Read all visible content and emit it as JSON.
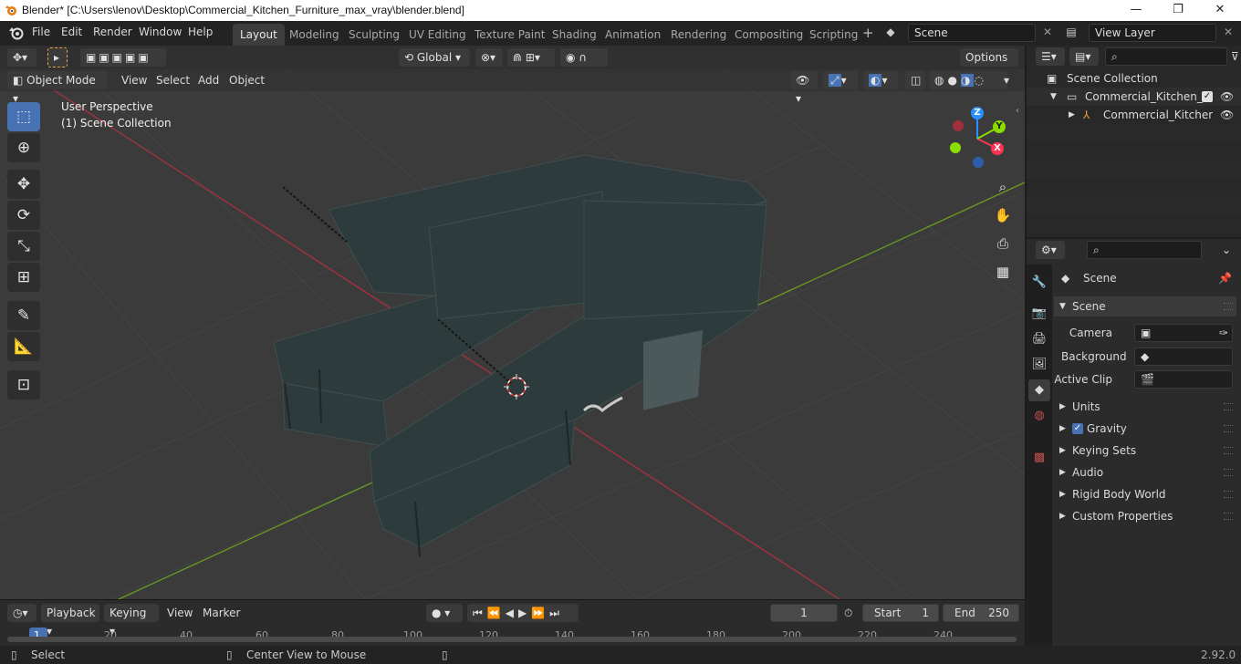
{
  "window": {
    "title": "Blender* [C:\\Users\\lenov\\Desktop\\Commercial_Kitchen_Furniture_max_vray\\blender.blend]",
    "minimize": "—",
    "maximize": "❐",
    "close": "✕"
  },
  "menu": [
    "File",
    "Edit",
    "Render",
    "Window",
    "Help"
  ],
  "workspaces": {
    "tabs": [
      "Layout",
      "Modeling",
      "Sculpting",
      "UV Editing",
      "Texture Paint",
      "Shading",
      "Animation",
      "Rendering",
      "Compositing",
      "Scripting"
    ],
    "active": "Layout",
    "add": "+"
  },
  "scene_selector": {
    "value": "Scene"
  },
  "view_layer_selector": {
    "value": "View Layer"
  },
  "viewport_header": {
    "transform_orientation": "Global",
    "options_label": "Options",
    "mode": "Object Mode",
    "menus": [
      "View",
      "Select",
      "Add",
      "Object"
    ]
  },
  "viewport_overlay": {
    "line1": "User Perspective",
    "line2": "(1) Scene Collection"
  },
  "gizmo": {
    "x": "X",
    "y": "Y",
    "z": "Z"
  },
  "timeline": {
    "menus": [
      "Playback",
      "Keying",
      "View",
      "Marker"
    ],
    "current_frame": "1",
    "start_label": "Start",
    "start_value": "1",
    "end_label": "End",
    "end_value": "250",
    "ruler_ticks": [
      "1",
      "20",
      "40",
      "60",
      "80",
      "100",
      "120",
      "140",
      "160",
      "180",
      "200",
      "220",
      "240"
    ]
  },
  "outliner": {
    "root": "Scene Collection",
    "items": [
      {
        "label": "Commercial_Kitchen_Fu"
      },
      {
        "label": "Commercial_Kitcher"
      }
    ]
  },
  "properties": {
    "context": "Scene",
    "panel_title": "Scene",
    "fields": [
      {
        "label": "Camera"
      },
      {
        "label": "Background ..."
      },
      {
        "label": "Active Clip"
      }
    ],
    "sections": [
      "Units",
      "Gravity",
      "Keying Sets",
      "Audio",
      "Rigid Body World",
      "Custom Properties"
    ]
  },
  "status": {
    "left": "Select",
    "middle": "Center View to Mouse",
    "version": "2.92.0"
  },
  "colors": {
    "accent": "#4772b3",
    "viewport_bg": "#3b3b3b",
    "axis_x": "#ff3352",
    "axis_y": "#8bdc00",
    "axis_z": "#2890ff"
  }
}
